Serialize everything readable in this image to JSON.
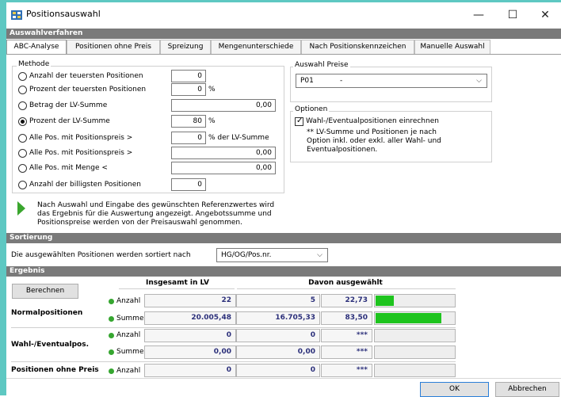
{
  "window": {
    "title": "Positionsauswahl",
    "minimize": "—",
    "maximize": "☐",
    "close": "✕"
  },
  "sections": {
    "auswahl": "Auswahlverfahren",
    "sortierung": "Sortierung",
    "ergebnis": "Ergebnis"
  },
  "tabs": [
    "ABC-Analyse",
    "Positionen ohne Preis",
    "Spreizung",
    "Mengenunterschiede",
    "Nach Positionskennzeichen",
    "Manuelle Auswahl"
  ],
  "methode": {
    "title": "Methode",
    "opt1": {
      "label": "Anzahl der teuersten Positionen",
      "value": "0",
      "unit": ""
    },
    "opt2": {
      "label": "Prozent der teuersten Positionen",
      "value": "0",
      "unit": "%"
    },
    "opt3": {
      "label": "Betrag der LV-Summe",
      "value": "0,00",
      "unit": ""
    },
    "opt4": {
      "label": "Prozent der LV-Summe",
      "value": "80",
      "unit": "%"
    },
    "opt5": {
      "label": "Alle Pos. mit Positionspreis >",
      "value": "0",
      "unit": "% der LV-Summe"
    },
    "opt6": {
      "label": "Alle Pos. mit Positionspreis >",
      "value": "0,00",
      "unit": ""
    },
    "opt7": {
      "label": "Alle Pos. mit Menge <",
      "value": "0,00",
      "unit": ""
    },
    "opt8": {
      "label": "Anzahl der billigsten Positionen",
      "value": "0",
      "unit": ""
    },
    "selected": 4
  },
  "preise": {
    "title": "Auswahl Preise",
    "code": "P01",
    "name": "-"
  },
  "optionen": {
    "title": "Optionen",
    "checkbox_label": "Wahl-/Eventualpositionen einrechnen",
    "checked": true,
    "note_line1": "** LV-Summe und Positionen je nach",
    "note_line2": "Option inkl. oder exkl. aller Wahl- und",
    "note_line3": "Eventualpositionen."
  },
  "hint": {
    "line1": "Nach Auswahl und Eingabe des gewünschten Referenzwertes wird",
    "line2": "das Ergebnis für die Auswertung angezeigt. Angebotssumme und",
    "line3": "Positionspreise werden von der Preisauswahl genommen."
  },
  "sortierung": {
    "label": "Die ausgewählten Positionen werden sortiert nach",
    "value": "HG/OG/Pos.nr."
  },
  "ergebnis": {
    "berechnen": "Berechnen",
    "col_total": "Insgesamt in LV",
    "col_selected": "Davon ausgewählt",
    "rows": {
      "normal": {
        "label": "Normalpositionen",
        "anzahl": {
          "label": "Anzahl",
          "total": "22",
          "selected": "5",
          "percent": "22,73",
          "fill": 0.2273
        },
        "summe": {
          "label": "Summe",
          "total": "20.005,48",
          "selected": "16.705,33",
          "percent": "83,50",
          "fill": 0.835
        }
      },
      "wahl": {
        "label": "Wahl-/Eventualpos.",
        "anzahl": {
          "label": "Anzahl",
          "total": "0",
          "selected": "0",
          "percent": "***",
          "fill": 0
        },
        "summe": {
          "label": "Summe",
          "total": "0,00",
          "selected": "0,00",
          "percent": "***",
          "fill": 0
        }
      },
      "ohne": {
        "label": "Positionen ohne Preis",
        "anzahl": {
          "label": "Anzahl",
          "total": "0",
          "selected": "0",
          "percent": "***",
          "fill": 0
        }
      }
    }
  },
  "footer": {
    "ok": "OK",
    "cancel": "Abbrechen"
  }
}
